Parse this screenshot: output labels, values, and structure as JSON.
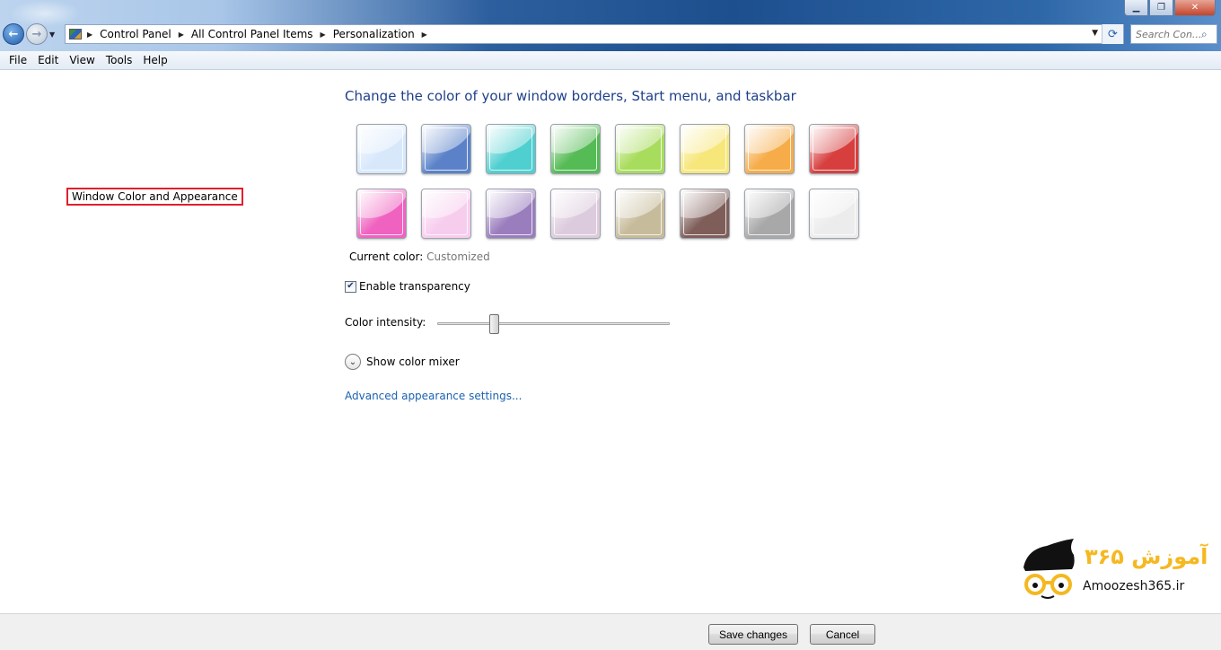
{
  "window": {
    "minimize_icon": "minimize-icon",
    "maximize_icon": "restore-icon",
    "close_icon": "close-icon"
  },
  "address": {
    "crumbs": [
      "Control Panel",
      "All Control Panel Items",
      "Personalization",
      "Window Color and Appearance"
    ]
  },
  "search": {
    "placeholder": "Search Con..."
  },
  "menu": {
    "items": [
      "File",
      "Edit",
      "View",
      "Tools",
      "Help"
    ]
  },
  "content": {
    "heading": "Change the color of your window borders, Start menu, and taskbar",
    "swatches": [
      {
        "color": "#d8e8fb"
      },
      {
        "color": "#5b82c9"
      },
      {
        "color": "#4fcfd0"
      },
      {
        "color": "#55bb55"
      },
      {
        "color": "#a8dc5c"
      },
      {
        "color": "#f7e67a"
      },
      {
        "color": "#f6ac48"
      },
      {
        "color": "#d73f3f"
      },
      {
        "color": "#f062bf"
      },
      {
        "color": "#f7cdee"
      },
      {
        "color": "#9a7dbd"
      },
      {
        "color": "#dccbdd"
      },
      {
        "color": "#c6bb9a"
      },
      {
        "color": "#7f5e5a"
      },
      {
        "color": "#a8a8a8"
      },
      {
        "color": "#ececec"
      }
    ],
    "current_color_label": "Current color:",
    "current_color_value": "Customized",
    "transparency_label": "Enable transparency",
    "transparency_checked": true,
    "intensity_label": "Color intensity:",
    "intensity_fraction": 0.23,
    "mixer_label": "Show color mixer",
    "advanced_link": "Advanced appearance settings..."
  },
  "watermark": {
    "site": "Amoozesh365.ir",
    "logo_text": "آموزش ۳۶۵"
  },
  "footer": {
    "save_label": "Save changes",
    "cancel_label": "Cancel"
  }
}
